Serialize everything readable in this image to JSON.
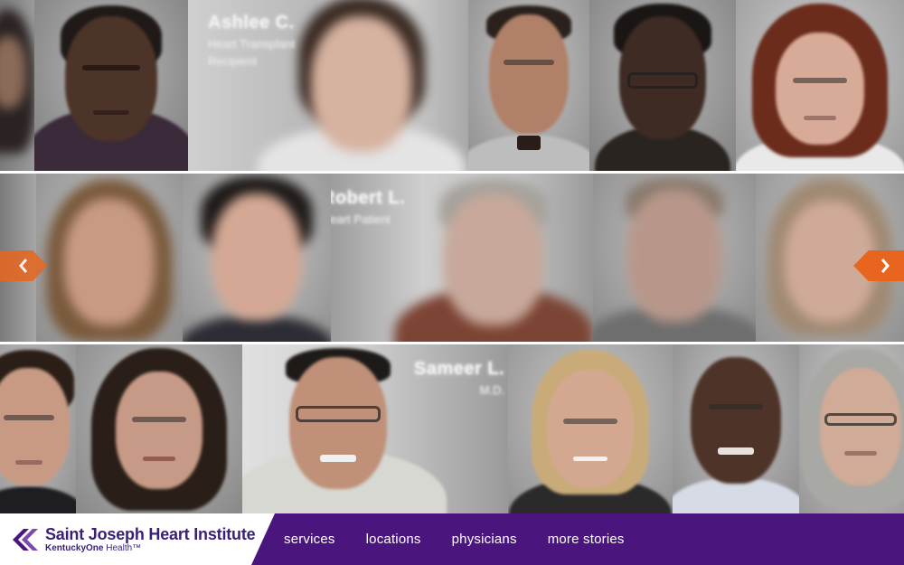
{
  "carousel": {
    "row1_caption": {
      "name": "Ashlee C.",
      "line1": "Heart Transplant",
      "line2": "Recipient"
    },
    "row2_caption": {
      "name": "Robert L.",
      "line1": "Heart Patient"
    },
    "row3_caption": {
      "name": "Sameer L.",
      "line1": "M.D."
    },
    "prev_arrow_icon": "chevron-left-icon",
    "next_arrow_icon": "chevron-right-icon",
    "accent_color": "#e8651f"
  },
  "footer": {
    "logo_title": "Saint Joseph Heart Institute",
    "logo_sub_brand": "KentuckyOne",
    "logo_sub_suffix": "Health™",
    "brand_color": "#3a1f78",
    "nav_color": "#4a167e",
    "nav": [
      {
        "label": "services"
      },
      {
        "label": "locations"
      },
      {
        "label": "physicians"
      },
      {
        "label": "more stories"
      }
    ]
  }
}
